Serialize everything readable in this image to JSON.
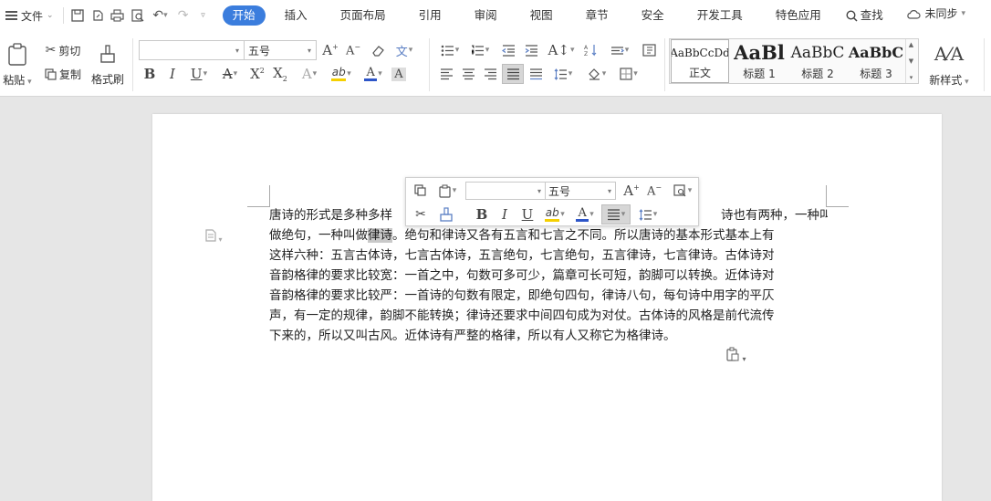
{
  "menubar": {
    "file_label": "文件",
    "tabs": [
      "开始",
      "插入",
      "页面布局",
      "引用",
      "审阅",
      "视图",
      "章节",
      "安全",
      "开发工具",
      "特色应用"
    ],
    "search_label": "查找",
    "sync_label": "未同步"
  },
  "ribbon": {
    "paste_label": "粘贴",
    "cut_label": "剪切",
    "copy_label": "复制",
    "format_painter_label": "格式刷",
    "font_name_value": "",
    "font_size_value": "五号",
    "styles": [
      {
        "sample": "AaBbCcDd",
        "name": "正文"
      },
      {
        "sample": "AaBl",
        "name": "标题 1"
      },
      {
        "sample": "AaBbC",
        "name": "标题 2"
      },
      {
        "sample": "AaBbC",
        "name": "标题 3"
      }
    ],
    "new_style_label": "新样式"
  },
  "floatbar": {
    "font_name_value": "",
    "font_size_value": "五号"
  },
  "document": {
    "lines": [
      {
        "pre": "唐诗的形式是多种多样",
        "hl": "",
        "post": "",
        "tail": "诗也有两种，一种叫"
      },
      {
        "pre": "做绝句，一种叫做",
        "hl": "律诗",
        "post": "。绝句和律诗又各有五言和七言之不同。所以唐诗的基本形式基本上有",
        "tail": ""
      },
      {
        "pre": "这样六种：五言古体诗，七言古体诗，五言绝句，七言绝句，五言律诗，七言律诗。古体诗对",
        "hl": "",
        "post": "",
        "tail": ""
      },
      {
        "pre": "音韵格律的要求比较宽：一首之中，句数可多可少，篇章可长可短，韵脚可以转换。近体诗对",
        "hl": "",
        "post": "",
        "tail": ""
      },
      {
        "pre": "音韵格律的要求比较严：一首诗的句数有限定，即绝句四句，律诗八句，每句诗中用字的平仄",
        "hl": "",
        "post": "",
        "tail": ""
      },
      {
        "pre": "声，有一定的规律，韵脚不能转换；律诗还要求中间四句成为对仗。古体诗的风格是前代流传",
        "hl": "",
        "post": "",
        "tail": ""
      },
      {
        "pre": "下来的，所以又叫古风。近体诗有严整的格律，所以有人又称它为格律诗。",
        "hl": "",
        "post": "",
        "tail": ""
      }
    ]
  },
  "colors": {
    "accent": "#3b7ddd",
    "highlight_yellow": "#f5d000",
    "font_color_blue": "#2d55c8"
  }
}
